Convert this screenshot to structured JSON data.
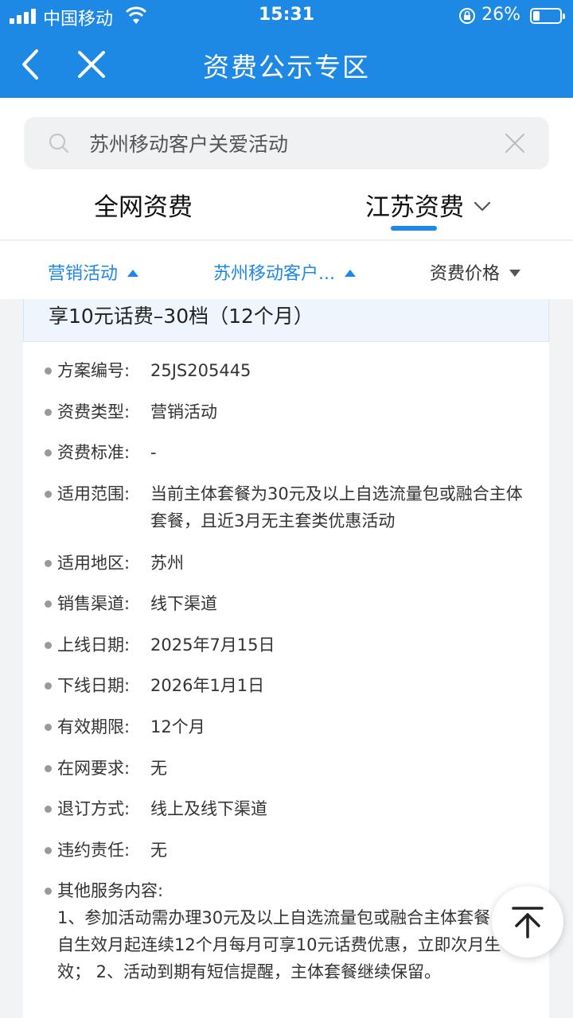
{
  "status_bar": {
    "carrier": "中国移动",
    "time": "15:31",
    "battery": "26%"
  },
  "nav": {
    "title": "资费公示专区"
  },
  "search": {
    "value": "苏州移动客户关爱活动"
  },
  "tabs": [
    {
      "label": "全网资费"
    },
    {
      "label": "江苏资费"
    }
  ],
  "filters": [
    {
      "label": "营销活动"
    },
    {
      "label": "苏州移动客户..."
    },
    {
      "label": "资费价格"
    }
  ],
  "plan": {
    "title": "享10元话费–30档（12个月）",
    "fields": [
      {
        "label": "方案编号:",
        "value": "25JS205445"
      },
      {
        "label": "资费类型:",
        "value": "营销活动"
      },
      {
        "label": "资费标准:",
        "value": "-"
      },
      {
        "label": "适用范围:",
        "value": "当前主体套餐为30元及以上自选流量包或融合主体套餐，且近3月无主套类优惠活动"
      },
      {
        "label": "适用地区:",
        "value": "苏州"
      },
      {
        "label": "销售渠道:",
        "value": "线下渠道"
      },
      {
        "label": "上线日期:",
        "value": "2025年7月15日"
      },
      {
        "label": "下线日期:",
        "value": "2026年1月1日"
      },
      {
        "label": "有效期限:",
        "value": "12个月"
      },
      {
        "label": "在网要求:",
        "value": "无"
      },
      {
        "label": "退订方式:",
        "value": "线上及线下渠道"
      },
      {
        "label": "违约责任:",
        "value": "无"
      }
    ],
    "other_label": "其他服务内容:",
    "other_value": "1、参加活动需办理30元及以上自选流量包或融合主体套餐，自生效月起连续12个月每月可享10元话费优惠，立即次月生效； 2、活动到期有短信提醒，主体套餐继续保留。"
  },
  "colors": {
    "brand": "#1e88e5"
  }
}
